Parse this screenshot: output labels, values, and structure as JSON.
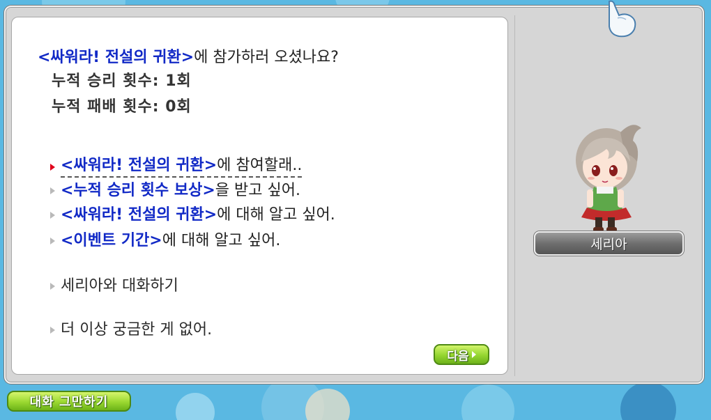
{
  "dialog": {
    "intro_event_name": "<싸워라! 전설의 귀환>",
    "intro_rest": "에 참가하러 오셨나요?",
    "wins_line": "누적 승리 횟수: 1회",
    "losses_line": "누적 패배 횟수: 0회",
    "options": [
      {
        "highlight": "<싸워라! 전설의 귀환>",
        "rest": "에 참여할래..",
        "selected": true
      },
      {
        "highlight": "<누적 승리 횟수 보상>",
        "rest": "을 받고 싶어.",
        "selected": false
      },
      {
        "highlight": "<싸워라! 전설의 귀환>",
        "rest": "에 대해 알고 싶어.",
        "selected": false
      },
      {
        "highlight": "<이벤트 기간>",
        "rest": "에 대해 알고 싶어.",
        "selected": false
      }
    ],
    "talk_option": "세리아와 대화하기",
    "no_more_option": "더 이상 궁금한 게 없어."
  },
  "buttons": {
    "next_label": "다음",
    "end_chat_label": "대화 그만하기"
  },
  "npc": {
    "name": "세리아"
  },
  "colors": {
    "highlight_blue": "#1129c6",
    "selected_bullet": "#e0001b",
    "button_green": "#94d530"
  }
}
